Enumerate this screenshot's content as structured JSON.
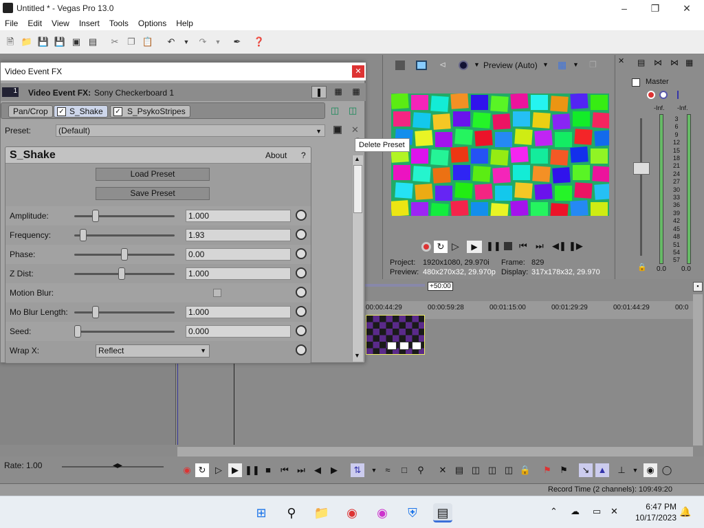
{
  "window": {
    "title": "Untitled * - Vegas Pro 13.0"
  },
  "menu": [
    "File",
    "Edit",
    "View",
    "Insert",
    "Tools",
    "Options",
    "Help"
  ],
  "fx": {
    "title": "Video Event FX",
    "header_label": "Video Event FX:",
    "header_name": "Sony Checkerboard 1",
    "header_track_num": "1",
    "chain": [
      "Pan/Crop",
      "S_Shake",
      "S_PsykoStripes"
    ],
    "preset_label": "Preset:",
    "preset_value": "(Default)",
    "tooltip": "Delete Preset",
    "plugin_name": "S_Shake",
    "about_label": "About",
    "help_label": "?",
    "load_preset": "Load Preset",
    "save_preset": "Save Preset",
    "params": [
      {
        "label": "Amplitude:",
        "value": "1.000",
        "slider": 0.19
      },
      {
        "label": "Frequency:",
        "value": "1.93",
        "slider": 0.06
      },
      {
        "label": "Phase:",
        "value": "0.00",
        "slider": 0.5
      },
      {
        "label": "Z Dist:",
        "value": "1.000",
        "slider": 0.47
      },
      {
        "label": "Motion Blur:",
        "value": "",
        "slider": null
      },
      {
        "label": "Mo Blur Length:",
        "value": "1.000",
        "slider": 0.19
      },
      {
        "label": "Seed:",
        "value": "0.000",
        "slider": 0.0
      },
      {
        "label": "Wrap X:",
        "value": "Reflect",
        "slider": null
      }
    ]
  },
  "preview": {
    "mode": "Preview (Auto)",
    "project_label": "Project:",
    "project_value": "1920x1080, 29.970i",
    "preview_label": "Preview:",
    "preview_value": "480x270x32, 29.970p",
    "frame_label": "Frame:",
    "frame_value": "829",
    "display_label": "Display:",
    "display_value": "317x178x32, 29.970"
  },
  "mixer": {
    "title": "Master",
    "levels": [
      "-Inf.",
      "-Inf."
    ],
    "scale": [
      "3",
      "6",
      "9",
      "12",
      "15",
      "18",
      "21",
      "24",
      "27",
      "30",
      "33",
      "36",
      "39",
      "42",
      "45",
      "48",
      "51",
      "54",
      "57"
    ],
    "bottom": [
      "0.0",
      "0.0"
    ]
  },
  "timeline": {
    "offset": "+50:00",
    "ticks": [
      "00:00:44:29",
      "00:00:59:28",
      "00:01:15:00",
      "00:01:29:29",
      "00:01:44:29",
      "00:0"
    ]
  },
  "rate": "Rate: 1.00",
  "status": "Record Time (2 channels): 109:49:20",
  "clock": {
    "time": "6:47 PM",
    "date": "10/17/2023"
  },
  "colors": {
    "accent": "#3a6fd8",
    "fxclose": "#d33333"
  }
}
